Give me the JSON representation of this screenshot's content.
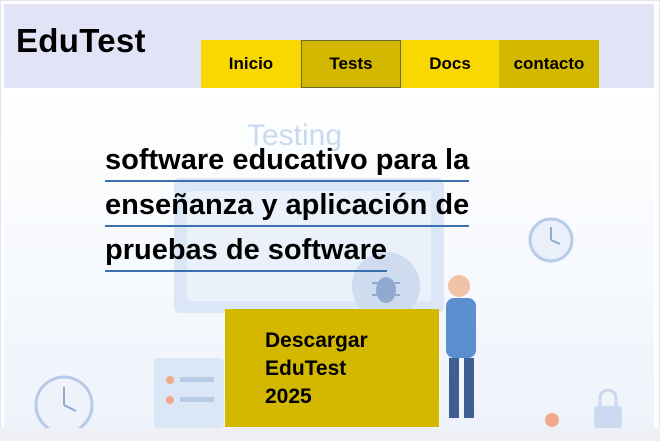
{
  "header": {
    "logo": "EduTest",
    "nav": [
      {
        "label": "Inicio"
      },
      {
        "label": "Tests"
      },
      {
        "label": "Docs"
      },
      {
        "label": "contacto"
      }
    ]
  },
  "hero": {
    "background_text": "Testing",
    "headline_lines": [
      "software educativo para la",
      "enseñanza y aplicación de",
      "pruebas de software"
    ],
    "cta_lines": [
      "Descargar",
      "EduTest",
      "2025"
    ]
  },
  "colors": {
    "header_bg": "#e3e3f8",
    "nav_yellow": "#f8d800",
    "nav_dark_yellow": "#d4b800",
    "underline_blue": "#3a6fb0"
  }
}
